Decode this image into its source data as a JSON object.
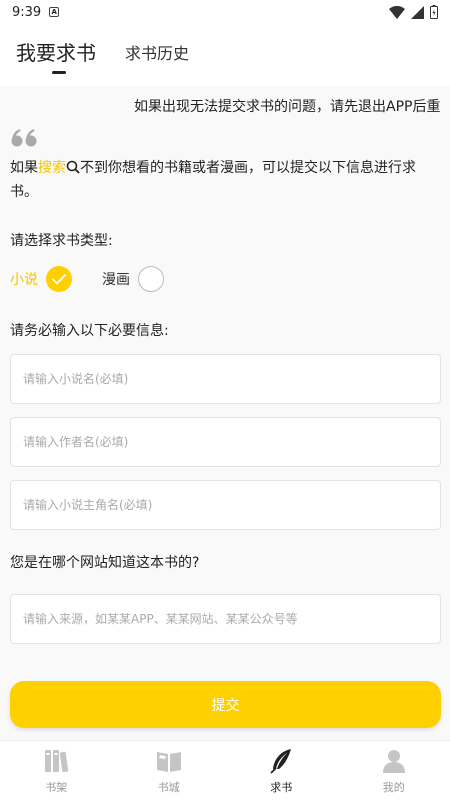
{
  "status": {
    "time": "9:39",
    "notif_glyph": "A"
  },
  "tabs": {
    "active": "我要求书",
    "inactive": "求书历史"
  },
  "marquee": "如果出现无法提交求书的问题，请先退出APP后重",
  "intro": {
    "pre": "如果",
    "highlight": "搜索",
    "post": "不到你想看的书籍或者漫画，可以提交以下信息进行求书。"
  },
  "type_label": "请选择求书类型:",
  "types": {
    "novel": "小说",
    "comic": "漫画",
    "selected": "小说"
  },
  "required_label": "请务必输入以下必要信息:",
  "fields": {
    "novel_name": "请输入小说名(必填)",
    "author_name": "请输入作者名(必填)",
    "protagonist_name": "请输入小说主角名(必填)"
  },
  "source_label": "您是在哪个网站知道这本书的?",
  "source_placeholder": "请输入来源，如某某APP、某某网站、某某公众号等",
  "submit_label": "提交",
  "nav": [
    {
      "label": "书架",
      "icon": "bookshelf-icon"
    },
    {
      "label": "书城",
      "icon": "book-open-icon"
    },
    {
      "label": "求书",
      "icon": "feather-icon",
      "active": true
    },
    {
      "label": "我的",
      "icon": "person-icon"
    }
  ],
  "colors": {
    "accent": "#ffd000",
    "highlight_text": "#f5c400"
  }
}
